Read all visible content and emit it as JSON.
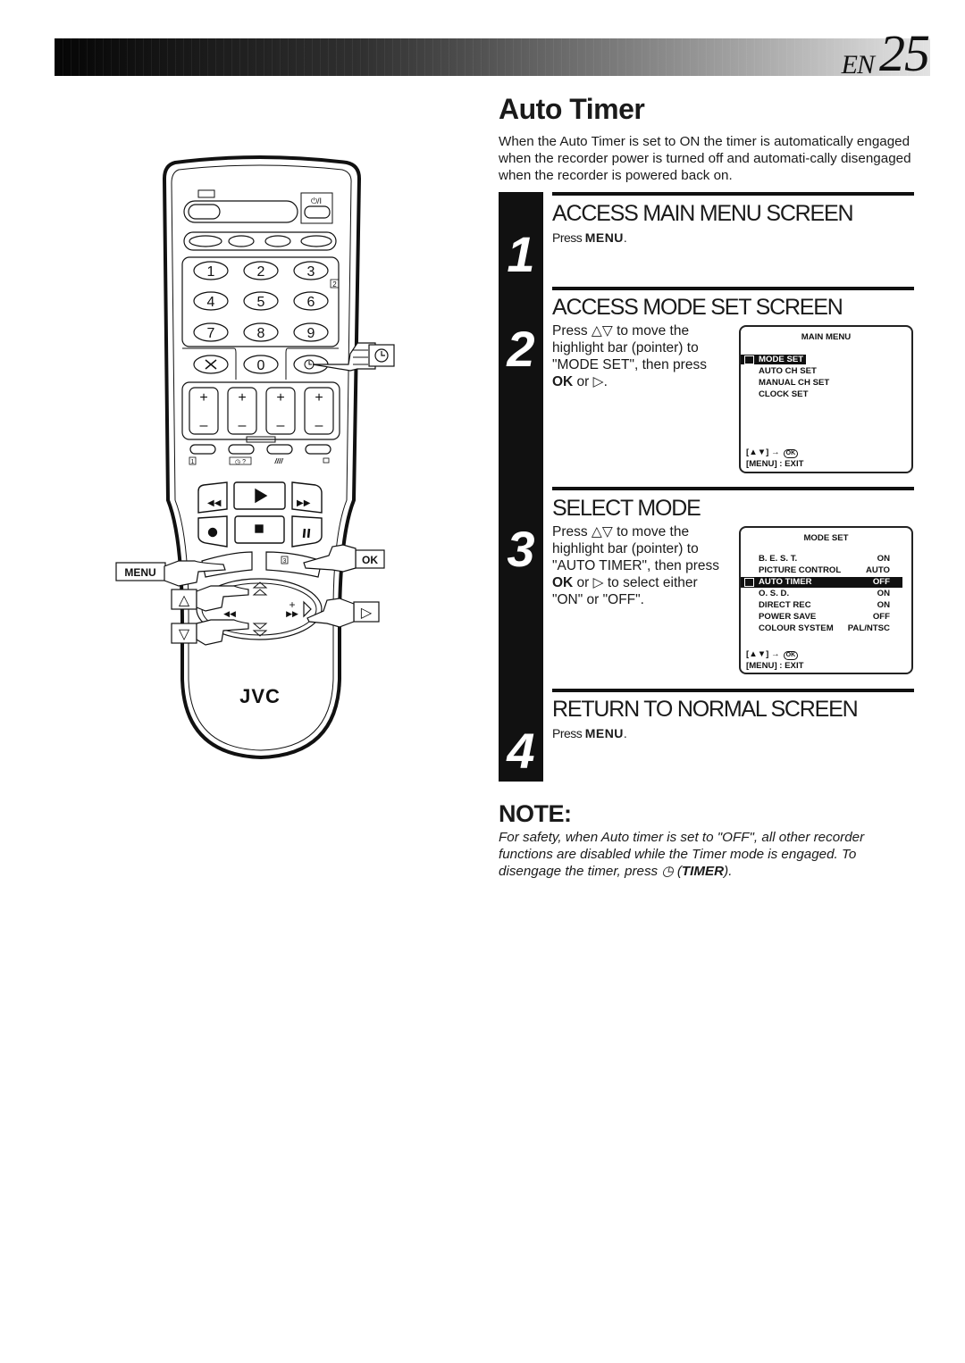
{
  "header": {
    "language": "EN",
    "page_number": "25"
  },
  "title": "Auto Timer",
  "intro": "When the Auto Timer is set to ON the timer is automatically engaged when the recorder power is turned off and automati-cally disengaged when the recorder is powered back on.",
  "steps": [
    {
      "number": "1",
      "heading": "ACCESS MAIN MENU SCREEN",
      "press_prefix": "Press",
      "press_key": "MENU",
      "press_suffix": "."
    },
    {
      "number": "2",
      "heading": "ACCESS MODE SET SCREEN",
      "text_parts": [
        "Press △▽ to move the highlight bar (pointer) to \"MODE SET\", then press ",
        "OK",
        " or ▷."
      ]
    },
    {
      "number": "3",
      "heading": "SELECT MODE",
      "text_parts": [
        "Press △▽ to move the highlight bar (pointer) to \"AUTO TIMER\", then press ",
        "OK",
        " or ▷ to select either \"ON\" or \"OFF\"."
      ]
    },
    {
      "number": "4",
      "heading": "RETURN TO NORMAL SCREEN",
      "press_prefix": "Press",
      "press_key": "MENU",
      "press_suffix": "."
    }
  ],
  "main_menu": {
    "title": "MAIN MENU",
    "items": [
      "MODE SET",
      "AUTO CH SET",
      "MANUAL CH SET",
      "CLOCK SET"
    ],
    "selected": "MODE SET",
    "footer_nav": "[▲▼] →",
    "footer_ok": "OK",
    "footer_exit": "[MENU] : EXIT"
  },
  "mode_set": {
    "title": "MODE SET",
    "items": [
      {
        "label": "B. E. S. T.",
        "value": "ON"
      },
      {
        "label": "PICTURE CONTROL",
        "value": "AUTO"
      },
      {
        "label": "AUTO TIMER",
        "value": "OFF"
      },
      {
        "label": "O. S. D.",
        "value": "ON"
      },
      {
        "label": "DIRECT REC",
        "value": "ON"
      },
      {
        "label": "POWER SAVE",
        "value": "OFF"
      },
      {
        "label": "COLOUR SYSTEM",
        "value": "PAL/NTSC"
      }
    ],
    "selected": "AUTO TIMER",
    "footer_nav": "[▲▼] →",
    "footer_ok": "OK",
    "footer_exit": "[MENU] : EXIT"
  },
  "note": {
    "heading": "NOTE:",
    "text_before": "For safety, when Auto timer is set to \"OFF\", all other recorder functions are disabled while the Timer mode is engaged. To disengage the timer, press ",
    "timer_icon": "◷",
    "text_key": "TIMER",
    "text_after": ")."
  },
  "remote": {
    "brand": "JVC",
    "power_label": "⏻/I",
    "number_keys": [
      "1",
      "2",
      "3",
      "4",
      "5",
      "6",
      "7",
      "8",
      "9",
      "0"
    ],
    "callouts": {
      "menu": "MENU",
      "ok": "OK",
      "up": "△",
      "down": "▽",
      "right": "▷",
      "timer": "◷"
    },
    "small_labels": {
      "box2": "2",
      "box3": "3",
      "box1": "1",
      "help": "◷ ?",
      "tv_slash": "////"
    }
  }
}
